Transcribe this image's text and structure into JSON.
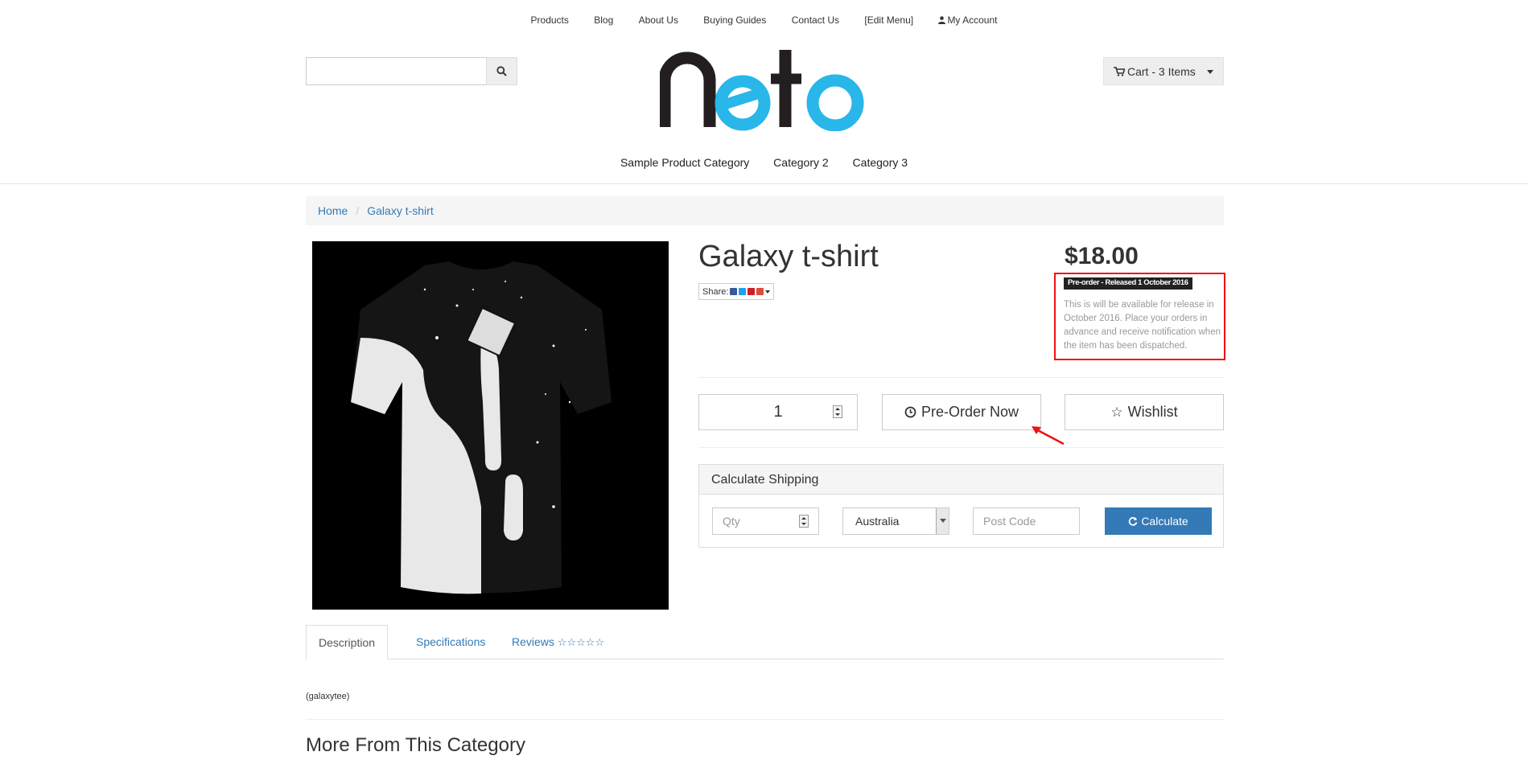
{
  "topnav": {
    "items": [
      "Products",
      "Blog",
      "About Us",
      "Buying Guides",
      "Contact Us",
      "[Edit Menu]"
    ],
    "account": "My Account"
  },
  "search": {
    "placeholder": ""
  },
  "logo": {
    "text": "neto",
    "colors": {
      "dark": "#231f20",
      "blue": "#29b6e8"
    }
  },
  "cart": {
    "label": "Cart - 3 Items"
  },
  "categories": [
    "Sample Product Category",
    "Category 2",
    "Category 3"
  ],
  "breadcrumb": {
    "home": "Home",
    "current": "Galaxy t-shirt"
  },
  "product": {
    "title": "Galaxy t-shirt",
    "share_label": "Share:",
    "price": "$18.00",
    "preorder_badge": "Pre-order - Released 1 October 2016",
    "preorder_text": "This is will be available for release in October 2016. Place your orders in advance and receive notification when the item has been dispatched.",
    "quantity": "1",
    "preorder_button": "Pre-Order Now",
    "wishlist_button": "Wishlist"
  },
  "shipping": {
    "title": "Calculate Shipping",
    "qty_placeholder": "Qty",
    "country": "Australia",
    "postcode_placeholder": "Post Code",
    "calculate_button": "Calculate"
  },
  "tabs": {
    "description": "Description",
    "specifications": "Specifications",
    "reviews": "Reviews",
    "review_stars": "☆☆☆☆☆"
  },
  "sku": "(galaxytee)",
  "more_heading": "More From This Category",
  "colors": {
    "link": "#337ab7",
    "primary_button": "#337ab7",
    "highlight_border": "#ee1111"
  }
}
